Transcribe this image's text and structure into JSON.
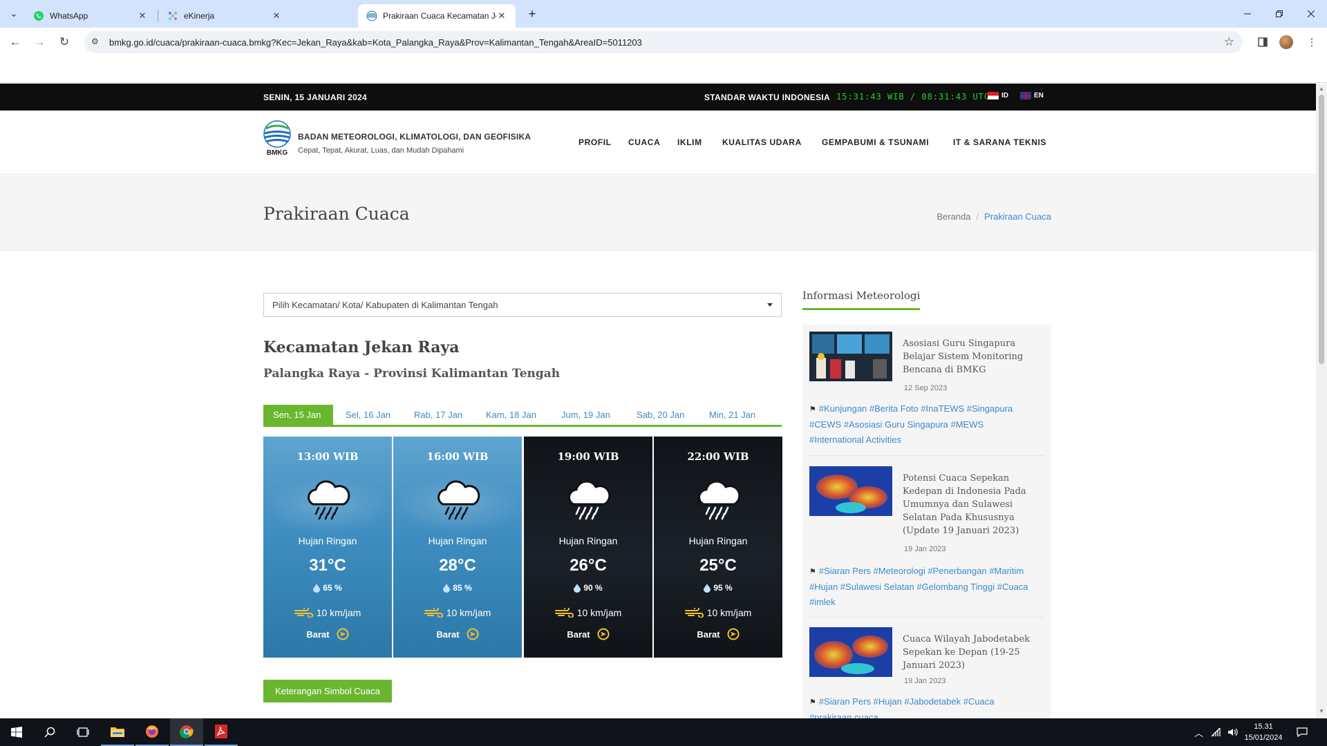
{
  "browser": {
    "tabs": [
      {
        "title": "WhatsApp",
        "icon": "whatsapp-icon"
      },
      {
        "title": "eKinerja",
        "icon": "ekinerja-icon"
      },
      {
        "title": "Prakiraan Cuaca Kecamatan Jek",
        "icon": "bmkg-icon"
      }
    ],
    "url": "bmkg.go.id/cuaca/prakiraan-cuaca.bmkg?Kec=Jekan_Raya&kab=Kota_Palangka_Raya&Prov=Kalimantan_Tengah&AreaID=5011203"
  },
  "topbar": {
    "date": "SENIN, 15 JANUARI 2024",
    "standard_label": "STANDAR WAKTU INDONESIA",
    "clock": "15:31:43 WIB / 08:31:43 UTC",
    "lang_id": "ID",
    "lang_en": "EN"
  },
  "header": {
    "logo_text": "BMKG",
    "org_name": "BADAN METEOROLOGI, KLIMATOLOGI, DAN GEOFISIKA",
    "tagline": "Cepat, Tepat, Akurat, Luas, dan Mudah Dipahami",
    "menu": [
      "PROFIL",
      "CUACA",
      "IKLIM",
      "KUALITAS UDARA",
      "GEMPABUMI & TSUNAMI",
      "IT & SARANA TEKNIS"
    ]
  },
  "titlebar": {
    "title": "Prakiraan Cuaca",
    "breadcrumb_home": "Beranda",
    "breadcrumb_sep": "/",
    "breadcrumb_current": "Prakiraan Cuaca"
  },
  "main": {
    "select_placeholder": "Pilih Kecamatan/ Kota/ Kabupaten di Kalimantan Tengah",
    "kecamatan": "Kecamatan Jekan Raya",
    "location": "Palangka Raya - Provinsi Kalimantan Tengah",
    "day_tabs": [
      "Sen, 15 Jan",
      "Sel, 16 Jan",
      "Rab, 17 Jan",
      "Kam, 18 Jan",
      "Jum, 19 Jan",
      "Sab, 20 Jan",
      "Min, 21 Jan"
    ],
    "forecasts": [
      {
        "time": "13:00 WIB",
        "condition": "Hujan Ringan",
        "temp": "31°C",
        "humidity": "65 %",
        "wind": "10 km/jam",
        "direction": "Barat",
        "theme": "day"
      },
      {
        "time": "16:00 WIB",
        "condition": "Hujan Ringan",
        "temp": "28°C",
        "humidity": "85 %",
        "wind": "10 km/jam",
        "direction": "Barat",
        "theme": "day"
      },
      {
        "time": "19:00 WIB",
        "condition": "Hujan Ringan",
        "temp": "26°C",
        "humidity": "90 %",
        "wind": "10 km/jam",
        "direction": "Barat",
        "theme": "night"
      },
      {
        "time": "22:00 WIB",
        "condition": "Hujan Ringan",
        "temp": "25°C",
        "humidity": "95 %",
        "wind": "10 km/jam",
        "direction": "Barat",
        "theme": "night"
      }
    ],
    "legend_button": "Keterangan Simbol Cuaca"
  },
  "sidebar": {
    "title": "Informasi Meteorologi",
    "news": [
      {
        "title": "Asosiasi Guru Singapura Belajar Sistem Monitoring Bencana di BMKG",
        "date": "12 Sep 2023",
        "tags": "#Kunjungan #Berita Foto #InaTEWS #Singapura #CEWS #Asosiasi Guru Singapura #MEWS #International Activities"
      },
      {
        "title": "Potensi Cuaca Sepekan Kedepan di Indonesia Pada Umumnya dan Sulawesi Selatan Pada Khususnya (Update 19 Januari 2023)",
        "date": "19 Jan 2023",
        "tags": "#Siaran Pers #Meteorologi #Penerbangan #Maritim #Hujan #Sulawesi Selatan #Gelombang Tinggi #Cuaca #imlek"
      },
      {
        "title": "Cuaca Wilayah Jabodetabek Sepekan ke Depan (19-25 Januari 2023)",
        "date": "19 Jan 2023",
        "tags": "#Siaran Pers #Hujan #Jabodetabek #Cuaca #prakiraan cuaca"
      }
    ]
  },
  "taskbar": {
    "time": "15.31",
    "date": "15/01/2024"
  },
  "colors": {
    "accent_green": "#6ab72f",
    "link_blue": "#3e89c8",
    "topbar_black": "#0e0e0e",
    "clock_green": "#23d12f"
  }
}
